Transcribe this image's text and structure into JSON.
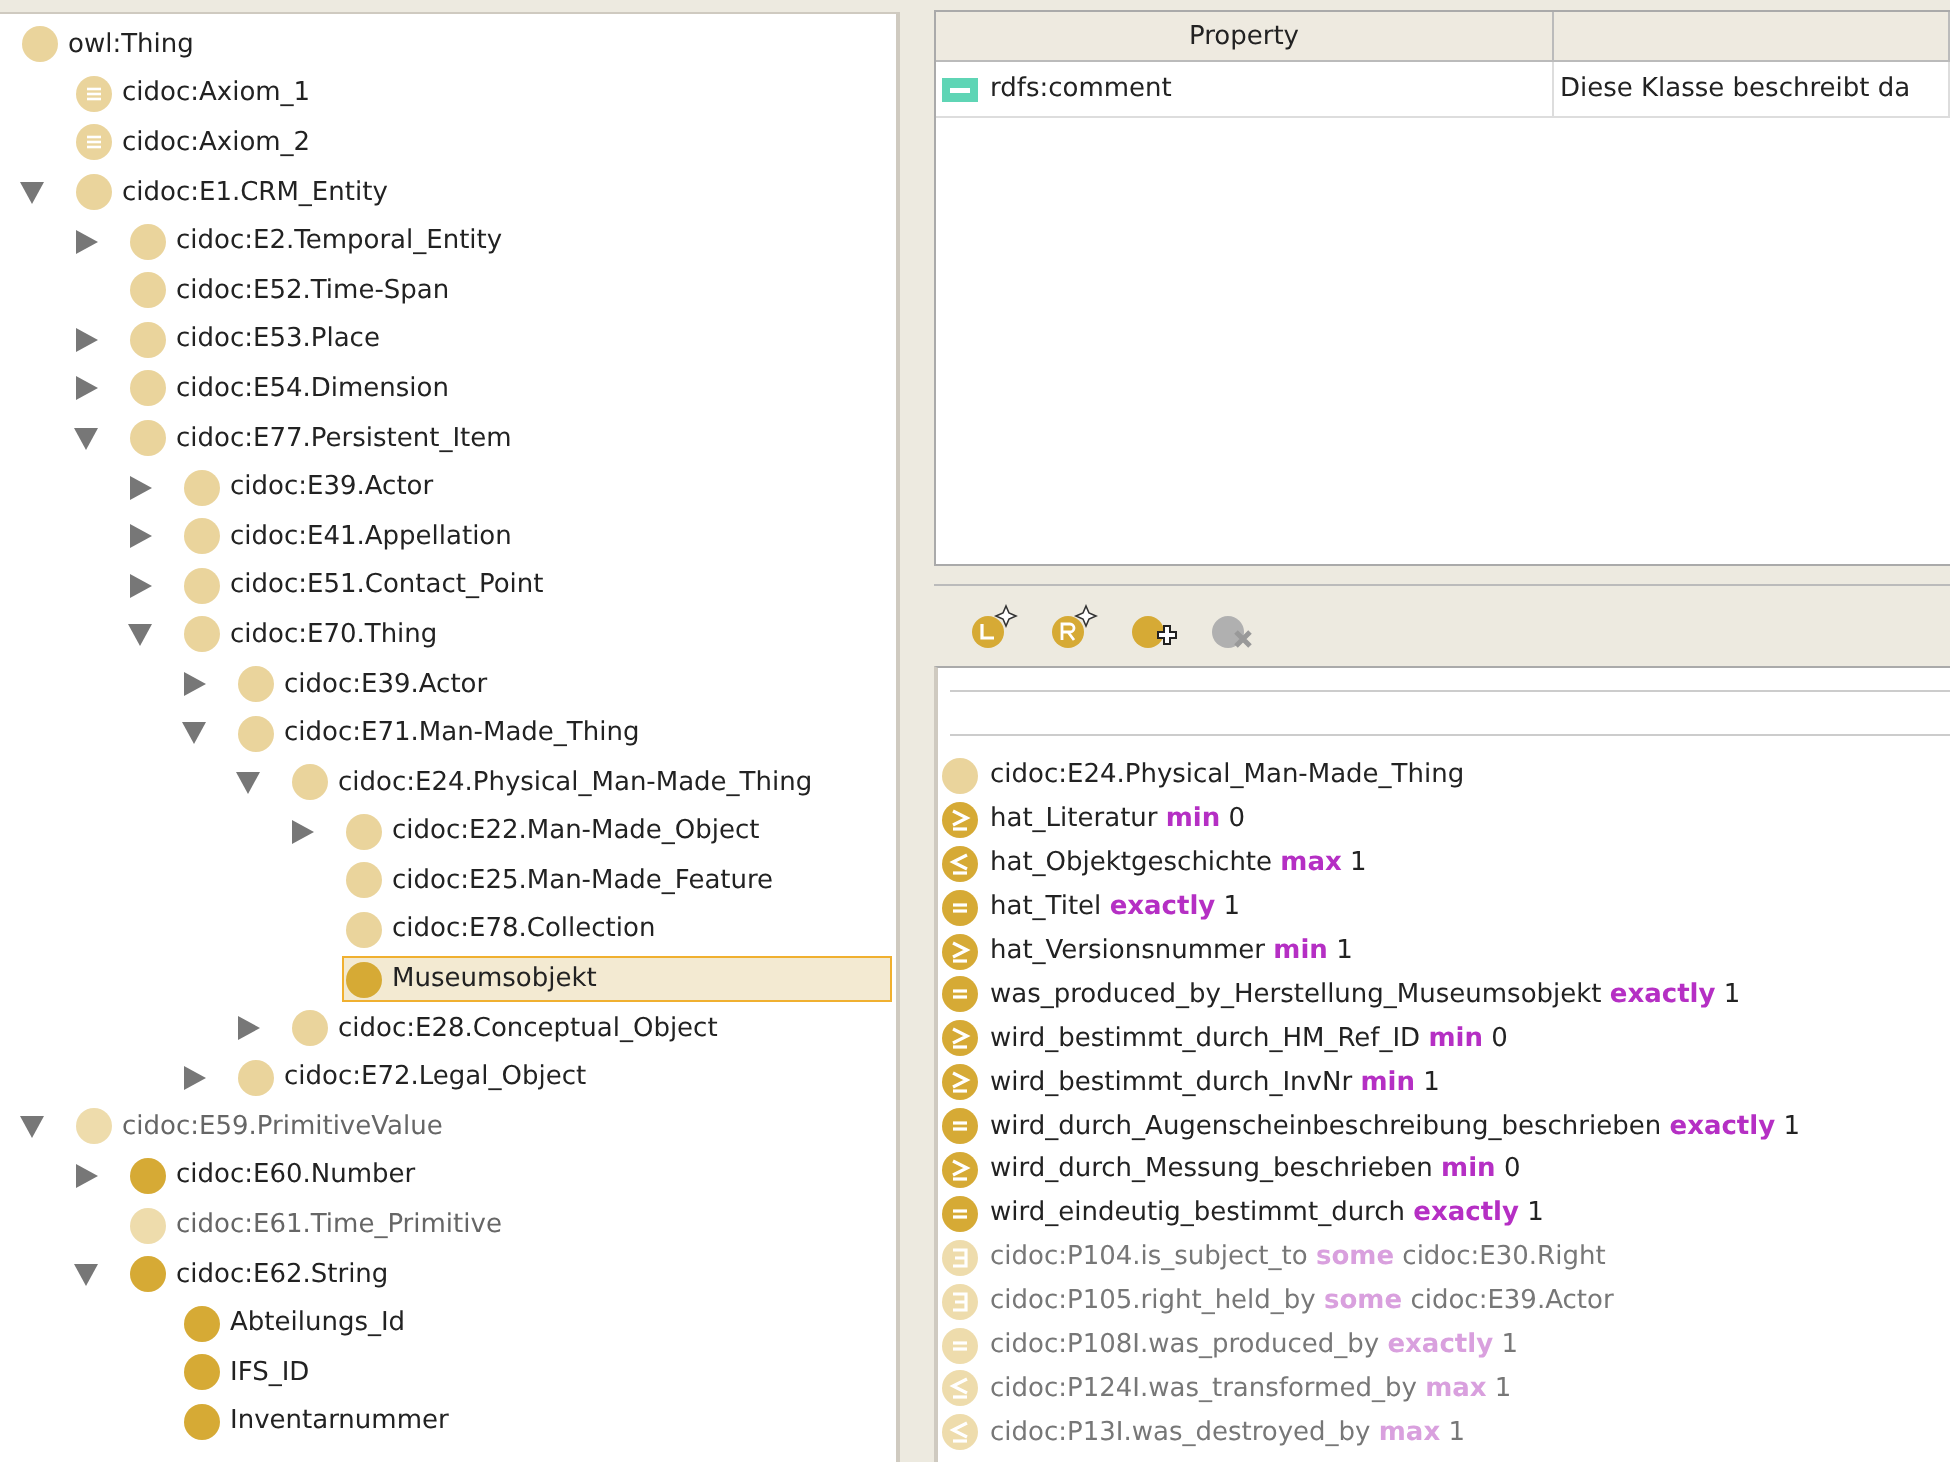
{
  "class_tree": [
    {
      "label": "owl:Thing",
      "kind": "class",
      "selected": false,
      "children": [
        {
          "label": "cidoc:Axiom_1",
          "kind": "individual",
          "selected": false
        },
        {
          "label": "cidoc:Axiom_2",
          "kind": "individual",
          "selected": false
        },
        {
          "label": "cidoc:E1.CRM_Entity",
          "kind": "class",
          "expanded": true,
          "selected": false,
          "children": [
            {
              "label": "cidoc:E2.Temporal_Entity",
              "kind": "class",
              "expanded": false,
              "selected": false
            },
            {
              "label": "cidoc:E52.Time-Span",
              "kind": "class",
              "selected": false
            },
            {
              "label": "cidoc:E53.Place",
              "kind": "class",
              "expanded": false,
              "selected": false
            },
            {
              "label": "cidoc:E54.Dimension",
              "kind": "class",
              "expanded": false,
              "selected": false
            },
            {
              "label": "cidoc:E77.Persistent_Item",
              "kind": "class",
              "expanded": true,
              "selected": false,
              "children": [
                {
                  "label": "cidoc:E39.Actor",
                  "kind": "class",
                  "expanded": false,
                  "selected": false
                },
                {
                  "label": "cidoc:E41.Appellation",
                  "kind": "class",
                  "expanded": false,
                  "selected": false
                },
                {
                  "label": "cidoc:E51.Contact_Point",
                  "kind": "class",
                  "expanded": false,
                  "selected": false
                },
                {
                  "label": "cidoc:E70.Thing",
                  "kind": "class",
                  "expanded": true,
                  "selected": false,
                  "children": [
                    {
                      "label": "cidoc:E39.Actor",
                      "kind": "class",
                      "expanded": false,
                      "selected": false
                    },
                    {
                      "label": "cidoc:E71.Man-Made_Thing",
                      "kind": "class",
                      "expanded": true,
                      "selected": false,
                      "children": [
                        {
                          "label": "cidoc:E24.Physical_Man-Made_Thing",
                          "kind": "class",
                          "expanded": true,
                          "selected": false,
                          "children": [
                            {
                              "label": "cidoc:E22.Man-Made_Object",
                              "kind": "class",
                              "expanded": false,
                              "selected": false
                            },
                            {
                              "label": "cidoc:E25.Man-Made_Feature",
                              "kind": "class",
                              "selected": false
                            },
                            {
                              "label": "cidoc:E78.Collection",
                              "kind": "class",
                              "selected": false
                            },
                            {
                              "label": "Museumsobjekt",
                              "kind": "strong",
                              "selected": true
                            }
                          ]
                        },
                        {
                          "label": "cidoc:E28.Conceptual_Object",
                          "kind": "class",
                          "expanded": false,
                          "selected": false
                        }
                      ]
                    },
                    {
                      "label": "cidoc:E72.Legal_Object",
                      "kind": "class",
                      "expanded": false,
                      "selected": false
                    }
                  ]
                }
              ]
            }
          ]
        },
        {
          "label": "cidoc:E59.PrimitiveValue",
          "kind": "faint",
          "expanded": true,
          "selected": false,
          "children": [
            {
              "label": "cidoc:E60.Number",
              "kind": "strong",
              "expanded": false,
              "selected": false
            },
            {
              "label": "cidoc:E61.Time_Primitive",
              "kind": "faint",
              "selected": false
            },
            {
              "label": "cidoc:E62.String",
              "kind": "strong",
              "expanded": true,
              "selected": false,
              "children": [
                {
                  "label": "Abteilungs_Id",
                  "kind": "strong",
                  "selected": false
                },
                {
                  "label": "IFS_ID",
                  "kind": "strong",
                  "selected": false
                },
                {
                  "label": "Inventarnummer",
                  "kind": "strong",
                  "selected": false
                }
              ]
            }
          ]
        }
      ]
    }
  ],
  "annotations": {
    "columns": [
      "Property"
    ],
    "rows": [
      {
        "property": "rdfs:comment",
        "value": "Diese Klasse beschreibt da"
      }
    ]
  },
  "toolbar": [
    {
      "kind": "add-left",
      "disabled": false
    },
    {
      "kind": "add-right",
      "disabled": false
    },
    {
      "kind": "add-class",
      "disabled": false
    },
    {
      "kind": "delete",
      "disabled": true
    }
  ],
  "description": [
    {
      "kind": "class",
      "inherited": false,
      "text": "cidoc:E24.Physical_Man-Made_Thing"
    },
    {
      "kind": "min",
      "inherited": false,
      "text": "hat_Literatur",
      "keyword": "min",
      "value": "0"
    },
    {
      "kind": "max",
      "inherited": false,
      "text": "hat_Objektgeschichte",
      "keyword": "max",
      "value": "1"
    },
    {
      "kind": "exactly",
      "inherited": false,
      "text": "hat_Titel",
      "keyword": "exactly",
      "value": "1"
    },
    {
      "kind": "min",
      "inherited": false,
      "text": "hat_Versionsnummer",
      "keyword": "min",
      "value": "1"
    },
    {
      "kind": "exactly",
      "inherited": false,
      "text": "was_produced_by_Herstellung_Museumsobjekt",
      "keyword": "exactly",
      "value": "1"
    },
    {
      "kind": "min",
      "inherited": false,
      "text": "wird_bestimmt_durch_HM_Ref_ID",
      "keyword": "min",
      "value": "0"
    },
    {
      "kind": "min",
      "inherited": false,
      "text": "wird_bestimmt_durch_InvNr",
      "keyword": "min",
      "value": "1"
    },
    {
      "kind": "exactly",
      "inherited": false,
      "text": "wird_durch_Augenscheinbeschreibung_beschrieben",
      "keyword": "exactly",
      "value": "1"
    },
    {
      "kind": "min",
      "inherited": false,
      "text": "wird_durch_Messung_beschrieben",
      "keyword": "min",
      "value": "0"
    },
    {
      "kind": "exactly",
      "inherited": false,
      "text": "wird_eindeutig_bestimmt_durch",
      "keyword": "exactly",
      "value": "1"
    },
    {
      "kind": "some",
      "inherited": true,
      "text": "cidoc:P104.is_subject_to",
      "keyword": "some",
      "value": "cidoc:E30.Right"
    },
    {
      "kind": "some",
      "inherited": true,
      "text": "cidoc:P105.right_held_by",
      "keyword": "some",
      "value": "cidoc:E39.Actor"
    },
    {
      "kind": "exactly",
      "inherited": true,
      "text": "cidoc:P108I.was_produced_by",
      "keyword": "exactly",
      "value": "1"
    },
    {
      "kind": "max",
      "inherited": true,
      "text": "cidoc:P124I.was_transformed_by",
      "keyword": "max",
      "value": "1"
    },
    {
      "kind": "max",
      "inherited": true,
      "text": "cidoc:P13I.was_destroyed_by",
      "keyword": "max",
      "value": "1"
    }
  ]
}
